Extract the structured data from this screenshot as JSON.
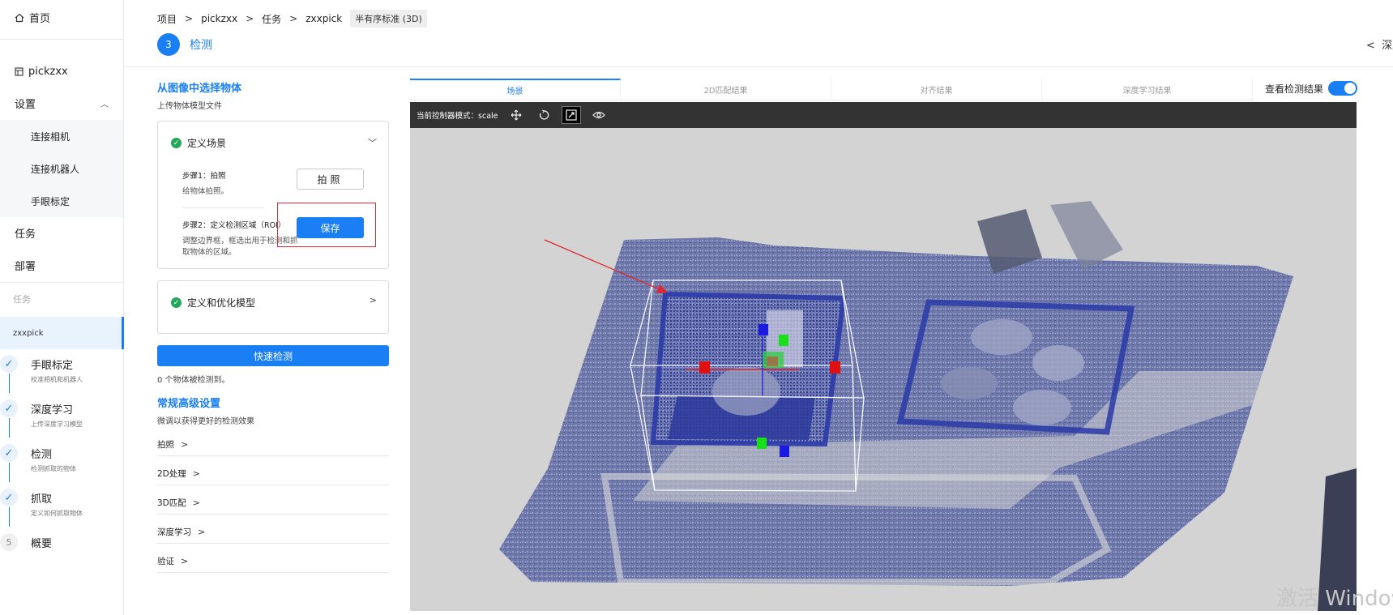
{
  "nav": {
    "home": "首页",
    "project": "pickzxx",
    "settings": "设置",
    "settings_items": [
      "连接相机",
      "连接机器人",
      "手眼标定"
    ],
    "tasks": "任务",
    "deploy": "部署",
    "task_caption": "任务",
    "current_task": "zxxpick",
    "steps": [
      {
        "title": "手眼标定",
        "subtitle": "校准相机和机器人"
      },
      {
        "title": "深度学习",
        "subtitle": "上传深度学习模型"
      },
      {
        "title": "检测",
        "subtitle": "检测抓取的物体"
      },
      {
        "title": "抓取",
        "subtitle": "定义如何抓取物体"
      },
      {
        "title": "概要",
        "number": "5"
      }
    ]
  },
  "breadcrumb": {
    "items": [
      "项目",
      "pickzxx",
      "任务",
      "zxxpick"
    ],
    "tag": "半有序标准 (3D)"
  },
  "step_header": {
    "number": "3",
    "name": "检测"
  },
  "back_link": "深度学习",
  "panel": {
    "title": "从图像中选择物体",
    "subtitle": "上传物体模型文件",
    "define_scene": {
      "title": "定义场景",
      "step1_title": "步骤1：拍照",
      "step1_desc": "给物体拍照。",
      "photo_button": "拍照",
      "step2_title": "步骤2：定义检测区域（ROI）",
      "step2_desc": "调整边界框，框选出用于检测和抓取物体的区域。",
      "save_button": "保存"
    },
    "define_model": {
      "title": "定义和优化模型"
    },
    "quick_detect": "快速检测",
    "detect_count": "0 个物体被检测到。",
    "advanced_title": "常规高级设置",
    "advanced_subtitle": "微调以获得更好的检测效果",
    "advanced_items": [
      "拍照",
      "2D处理",
      "3D匹配",
      "深度学习",
      "验证"
    ]
  },
  "viewer": {
    "tabs": [
      "场景",
      "2D匹配结果",
      "对齐结果",
      "深度学习结果"
    ],
    "view_results_label": "查看检测结果",
    "view_results_on": true,
    "mode_label": "当前控制器模式：",
    "mode_value": "scale",
    "tools": [
      "move-icon",
      "rotate-icon",
      "scale-icon",
      "eye-icon"
    ]
  },
  "watermark": "激活 Windows",
  "colors": {
    "accent": "#1a7ff5",
    "success": "#26a65b",
    "annotation": "#e0282f",
    "toolbar": "#333333",
    "viewer_bg": "#d3d3d3",
    "pointcloud": "#6a73a8",
    "roi_box": "#2a3aa8"
  }
}
